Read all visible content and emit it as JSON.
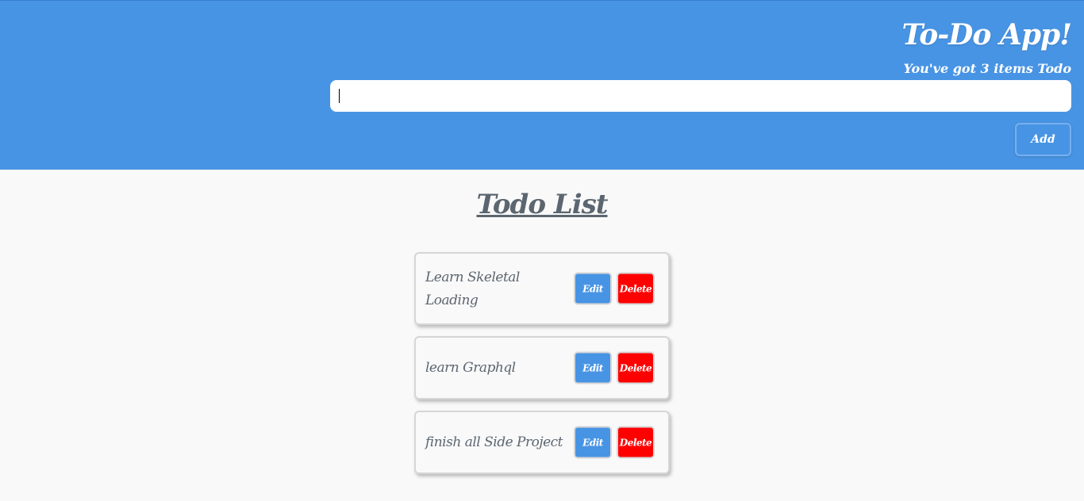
{
  "header": {
    "title": "To-Do App!",
    "subtitle": "You've got 3 items Todo",
    "input_value": "",
    "add_label": "Add"
  },
  "list": {
    "title": "Todo List",
    "items": [
      {
        "text": "Learn Skeletal Loading",
        "edit_label": "Edit",
        "delete_label": "Delete"
      },
      {
        "text": "learn Graphql",
        "edit_label": "Edit",
        "delete_label": "Delete"
      },
      {
        "text": "finish all Side Project",
        "edit_label": "Edit",
        "delete_label": "Delete"
      }
    ]
  },
  "colors": {
    "header_bg": "#4894e4",
    "edit_button": "#4894e4",
    "delete_button": "#ff0000",
    "text_gray": "#5c6670",
    "page_bg": "#f9f9f9"
  }
}
